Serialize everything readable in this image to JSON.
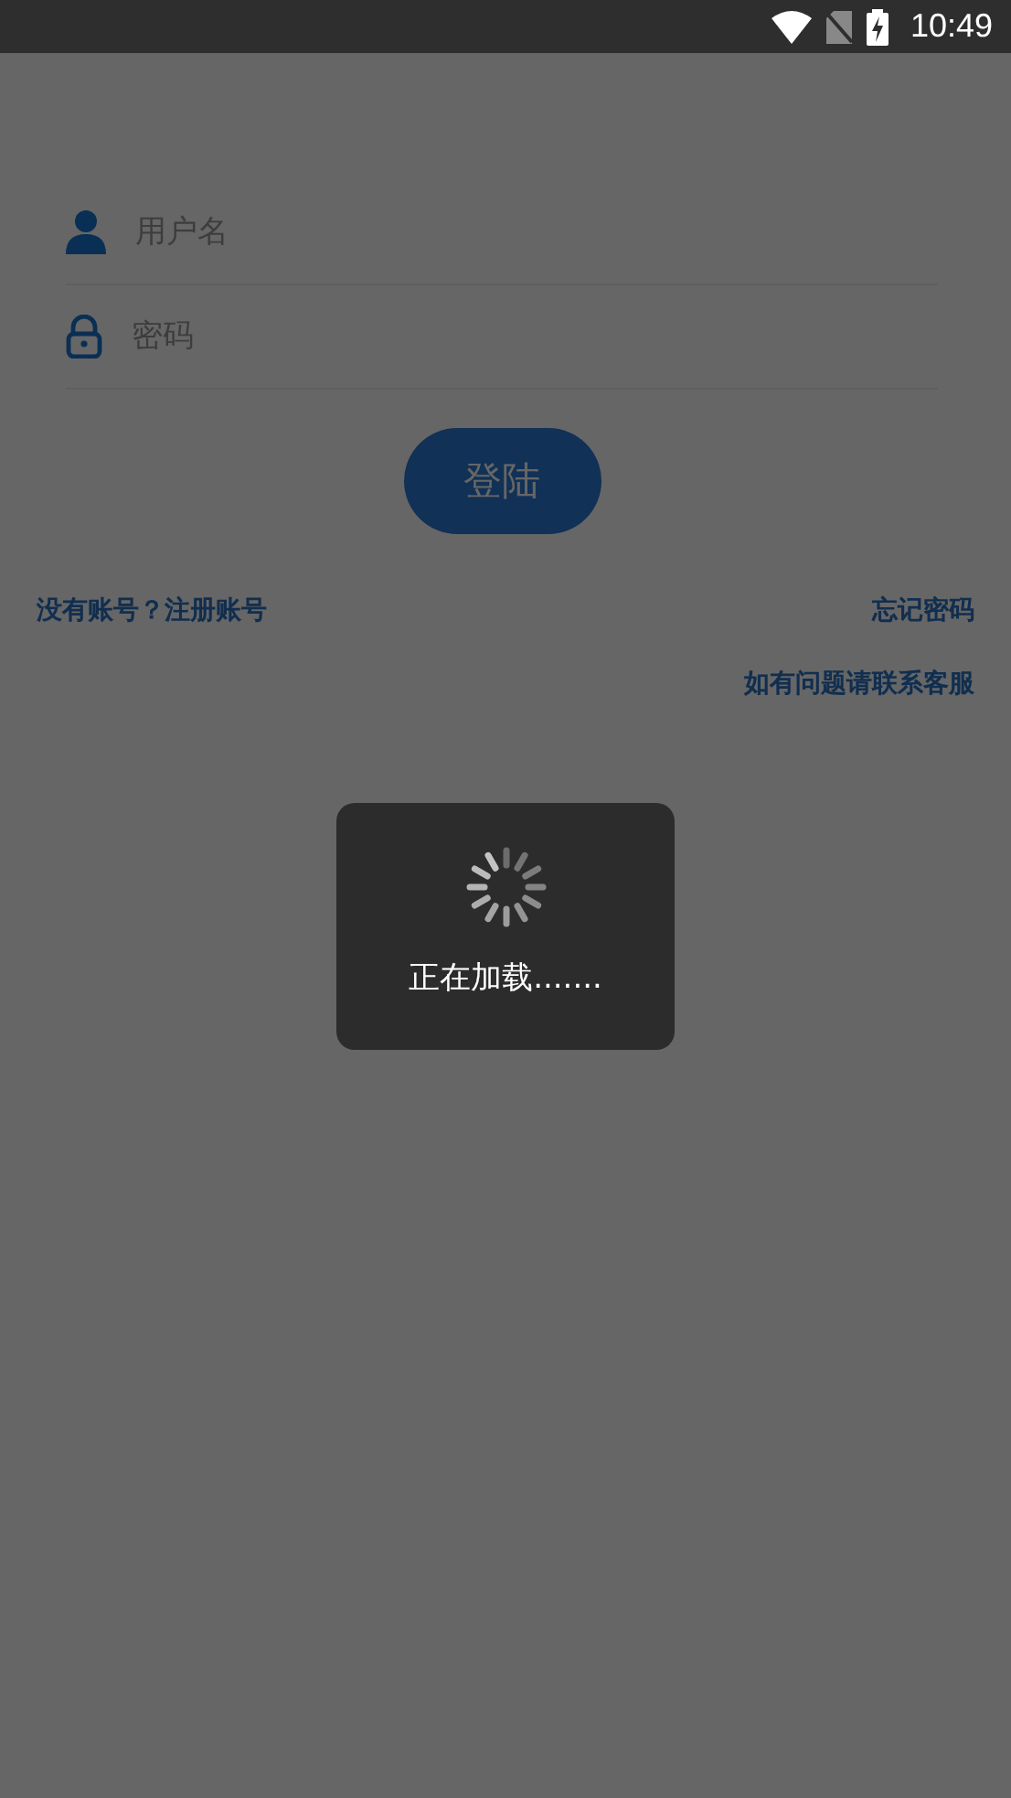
{
  "status_bar": {
    "time": "10:49"
  },
  "login_form": {
    "username": {
      "placeholder": "用户名"
    },
    "password": {
      "placeholder": "密码"
    },
    "submit": "登陆"
  },
  "links": {
    "register": "没有账号？注册账号",
    "forgot": "忘记密码",
    "support": "如有问题请联系客服"
  },
  "loading_dialog": {
    "message": "正在加载......."
  }
}
